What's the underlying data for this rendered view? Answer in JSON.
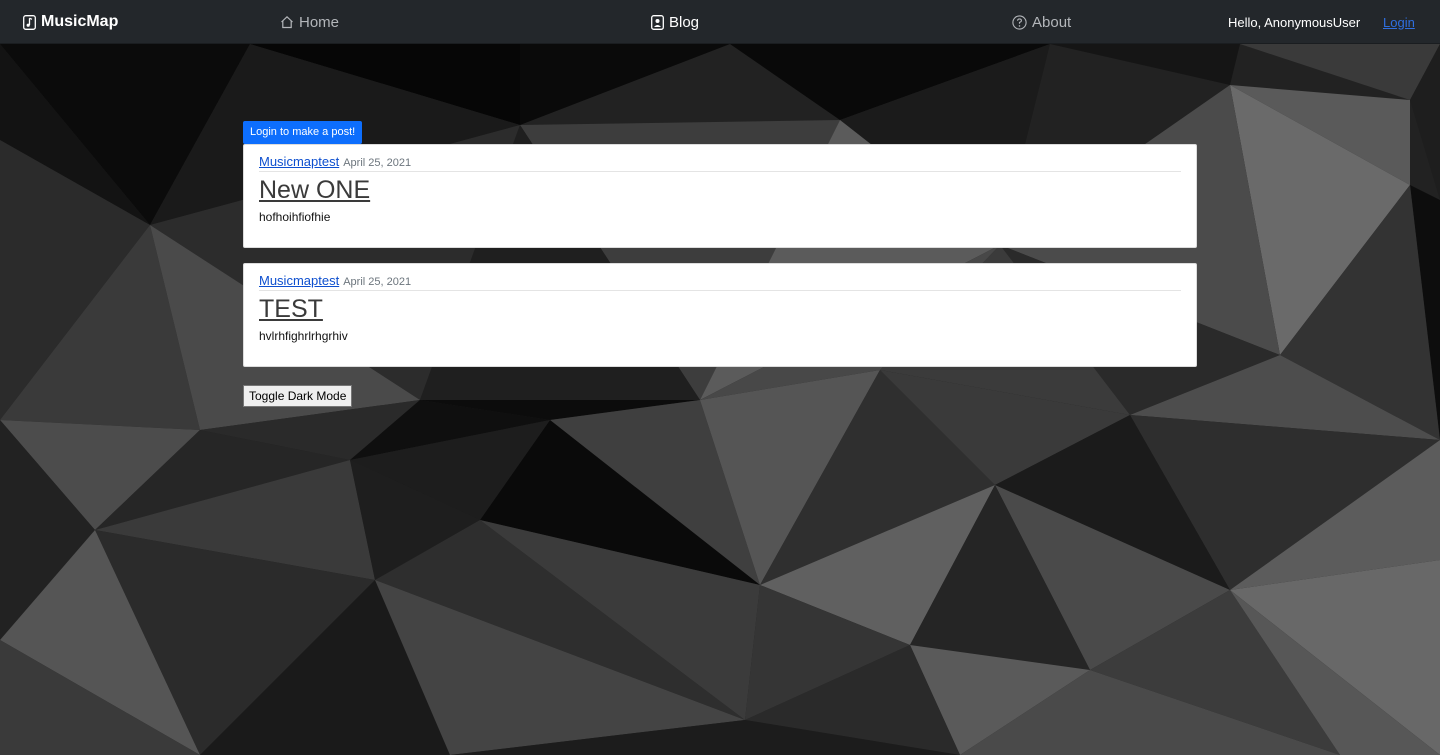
{
  "navbar": {
    "brand": "MusicMap",
    "links": [
      {
        "label": "Home",
        "icon": "home-icon"
      },
      {
        "label": "Blog",
        "icon": "blog-icon"
      },
      {
        "label": "About",
        "icon": "help-circle-icon"
      }
    ],
    "greeting": "Hello, AnonymousUser",
    "login_label": "Login"
  },
  "main": {
    "login_post_button": "Login to make a post!",
    "posts": [
      {
        "author": "Musicmaptest",
        "date": "April 25, 2021",
        "title": "New ONE",
        "body": "hofhoihfiofhie"
      },
      {
        "author": "Musicmaptest",
        "date": "April 25, 2021",
        "title": "TEST",
        "body": "hvlrhfighrlrhgrhiv"
      }
    ],
    "toggle_dark_mode": "Toggle Dark Mode"
  },
  "colors": {
    "navbar_bg": "#23272b",
    "primary": "#0d6efd",
    "link": "#0d4fcf"
  }
}
